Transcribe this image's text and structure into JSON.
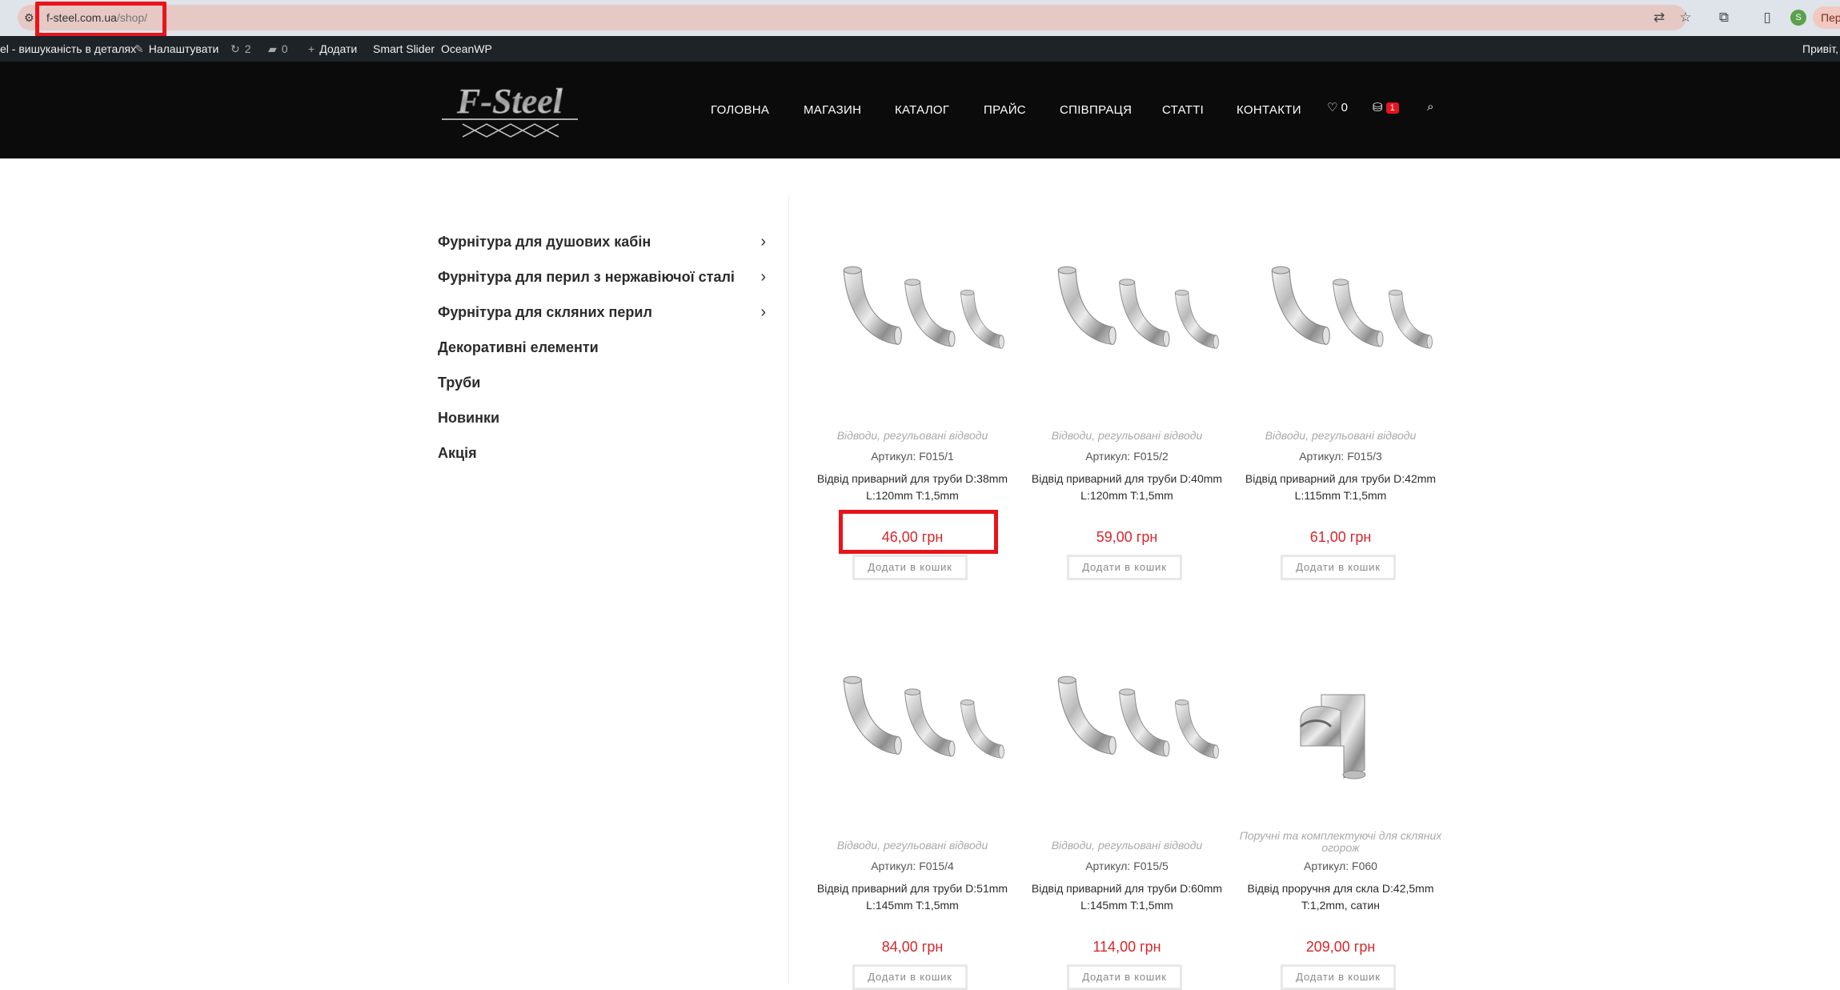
{
  "browser": {
    "url_host": "f-steel.com.ua",
    "url_path": "/shop/",
    "profile_initial": "S",
    "profile_label": "Пер"
  },
  "admin_bar": {
    "site_name": "el - вишуканість в деталях",
    "customize": "Налаштувати",
    "updates_count": "2",
    "comments_count": "0",
    "new": "Додати",
    "smart_slider": "Smart Slider",
    "oceanwp": "OceanWP",
    "greeting": "Привіт,"
  },
  "header": {
    "logo_text": "F-Steel",
    "nav": [
      "ГОЛОВНА",
      "МАГАЗИН",
      "КАТАЛОГ",
      "ПРАЙС",
      "СПІВПРАЦЯ",
      "СТАТТІ",
      "КОНТАКТИ"
    ],
    "wishlist_count": "0",
    "cart_count": "1"
  },
  "sidebar": {
    "categories": [
      {
        "label": "Фурнітура для душових кабін",
        "has_children": true
      },
      {
        "label": "Фурнітура для перил з нержавіючої сталі",
        "has_children": true
      },
      {
        "label": "Фурнітура для скляних перил",
        "has_children": true
      },
      {
        "label": "Декоративні елементи",
        "has_children": false
      },
      {
        "label": "Труби",
        "has_children": false
      },
      {
        "label": "Новинки",
        "has_children": false
      },
      {
        "label": "Акція",
        "has_children": false
      }
    ]
  },
  "products": [
    {
      "category": "Відводи, регульовані відводи",
      "sku": "Артикул: F015/1",
      "title": "Відвід приварний для труби D:38mm L:120mm T:1,5mm",
      "price": "46,00 грн",
      "button": "Додати в кошик",
      "image": "elbow-set"
    },
    {
      "category": "Відводи, регульовані відводи",
      "sku": "Артикул: F015/2",
      "title": "Відвід приварний для труби D:40mm L:120mm T:1,5mm",
      "price": "59,00 грн",
      "button": "Додати в кошик",
      "image": "elbow-set"
    },
    {
      "category": "Відводи, регульовані відводи",
      "sku": "Артикул: F015/3",
      "title": "Відвід приварний для труби D:42mm L:115mm T:1,5mm",
      "price": "61,00 грн",
      "button": "Додати в кошик",
      "image": "elbow-set"
    },
    {
      "category": "Відводи, регульовані відводи",
      "sku": "Артикул: F015/4",
      "title": "Відвід приварний для труби D:51mm L:145mm T:1,5mm",
      "price": "84,00 грн",
      "button": "Додати в кошик",
      "image": "elbow-set"
    },
    {
      "category": "Відводи, регульовані відводи",
      "sku": "Артикул: F015/5",
      "title": "Відвід приварний для труби D:60mm L:145mm T:1,5mm",
      "price": "114,00 грн",
      "button": "Додати в кошик",
      "image": "elbow-set"
    },
    {
      "category": "Поручні та комплектуючі для скляних огорож",
      "sku": "Артикул: F060",
      "title": "Відвід проручня для скла D:42,5mm T:1,2mm, сатин",
      "price": "209,00 грн",
      "button": "Додати в кошик",
      "image": "handrail-elbow"
    }
  ]
}
